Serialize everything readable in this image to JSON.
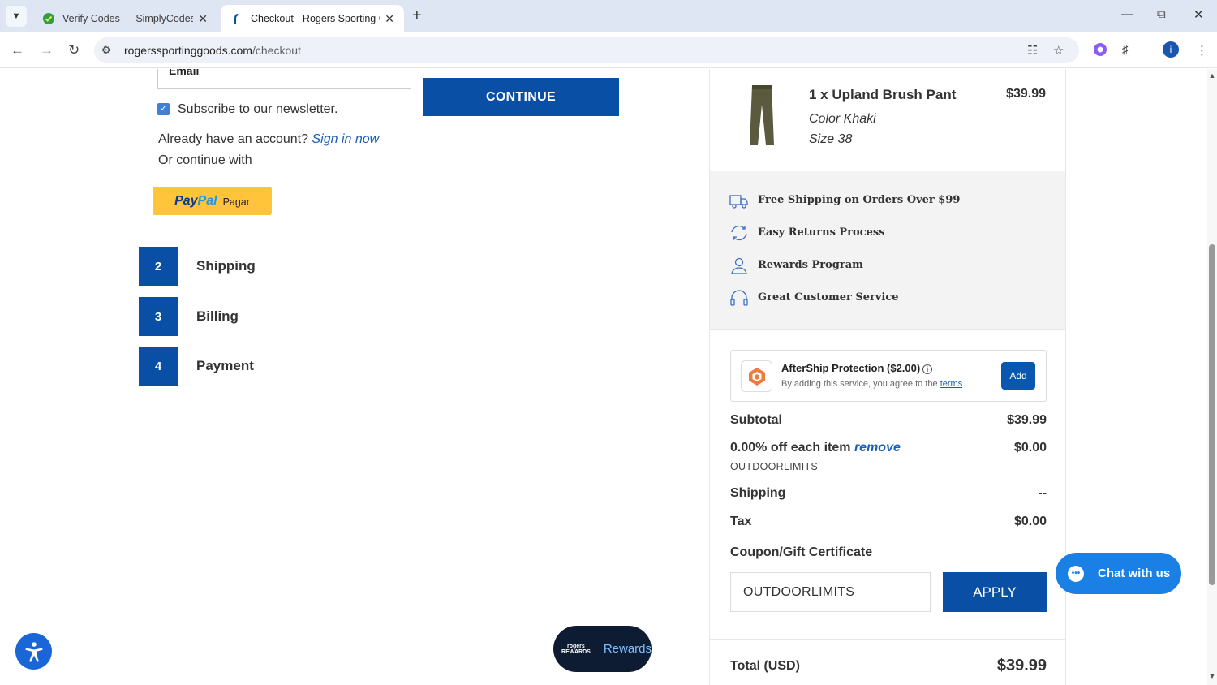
{
  "browser": {
    "tabs": [
      {
        "title": "Verify Codes — SimplyCodes",
        "active": false,
        "icon": "simplycodes-favicon"
      },
      {
        "title": "Checkout - Rogers Sporting Goods",
        "active": true,
        "icon": "rogers-favicon"
      }
    ],
    "url_domain": "rogerssportinggoods.com",
    "url_path": "/checkout",
    "profile_initial": "i"
  },
  "form": {
    "email_label": "Email",
    "continue_label": "CONTINUE",
    "newsletter_label": "Subscribe to our newsletter.",
    "newsletter_checked": true,
    "account_prompt": "Already have an account?",
    "sign_in_label": "Sign in now",
    "or_continue": "Or continue with",
    "paypal": {
      "brand_a": "Pay",
      "brand_b": "Pal",
      "action": "Pagar"
    }
  },
  "steps": [
    {
      "number": "2",
      "label": "Shipping"
    },
    {
      "number": "3",
      "label": "Billing"
    },
    {
      "number": "4",
      "label": "Payment"
    }
  ],
  "cart": {
    "item_name": "1 x Upland Brush Pant",
    "item_price": "$39.99",
    "color": "Color Khaki",
    "size": "Size 38"
  },
  "perks": [
    {
      "icon": "truck-icon",
      "label": "Free Shipping on Orders Over $99"
    },
    {
      "icon": "returns-icon",
      "label": "Easy Returns Process"
    },
    {
      "icon": "user-icon",
      "label": "Rewards Program"
    },
    {
      "icon": "headset-icon",
      "label": "Great Customer Service"
    }
  ],
  "aftership": {
    "title": "AfterShip Protection ($2.00)",
    "subtitle": "By adding this service, you agree to the",
    "terms_label": "terms",
    "add_label": "Add"
  },
  "totals": {
    "subtotal_label": "Subtotal",
    "subtotal_value": "$39.99",
    "discount_label": "0.00% off each item",
    "discount_remove": "remove",
    "discount_value": "$0.00",
    "discount_code": "OUTDOORLIMITS",
    "shipping_label": "Shipping",
    "shipping_value": "--",
    "tax_label": "Tax",
    "tax_value": "$0.00",
    "coupon_label": "Coupon/Gift Certificate",
    "coupon_value": "OUTDOORLIMITS",
    "apply_label": "APPLY",
    "total_label": "Total (USD)",
    "total_value": "$39.99"
  },
  "widgets": {
    "rewards_logo": "rogers REWARDS",
    "rewards_label": "Rewards",
    "chat_label": "Chat with us"
  },
  "colors": {
    "brand_blue": "#0a4fa6",
    "chat_blue": "#1a80e6",
    "paypal_yellow": "#ffc439",
    "rewards_dark": "#0e1c33"
  }
}
